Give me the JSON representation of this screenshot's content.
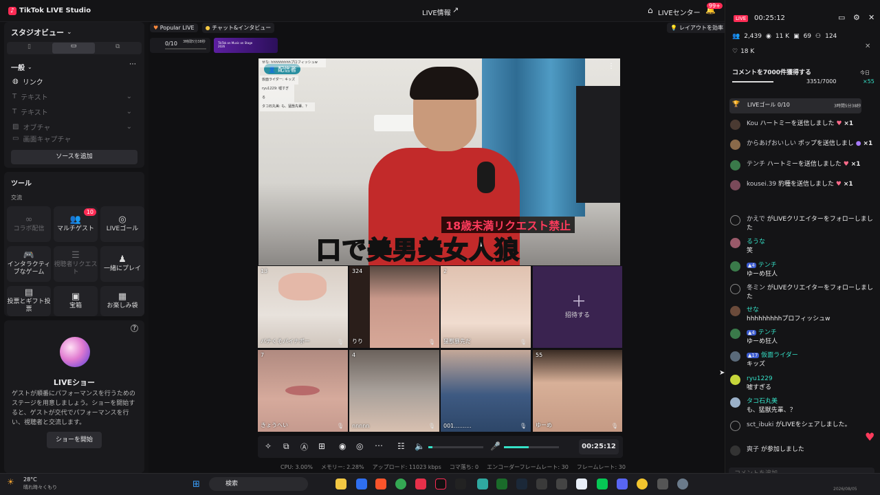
{
  "topbar": {
    "app_title": "TikTok LIVE Studio",
    "center_title": "LIVE情報",
    "live_center": "LIVEセンター",
    "notif_badge": "99+"
  },
  "left": {
    "studio_view": "スタジオビュー",
    "section_general": "一般",
    "sources": [
      "リンク",
      "テキスト",
      "テキスト",
      "オブチャ",
      "画面キャプチャ"
    ],
    "add_source": "ソースを追加",
    "tools_title": "ツール",
    "exchange": "交流",
    "tiles": [
      {
        "label": "コラボ配信",
        "icon": "collab-icon"
      },
      {
        "label": "マルチゲスト",
        "icon": "multiguest-icon",
        "badge": "10"
      },
      {
        "label": "LIVEゴール",
        "icon": "goal-icon"
      },
      {
        "label": "インタラクティブなゲーム",
        "icon": "game-icon"
      },
      {
        "label": "視聴者リクエスト",
        "icon": "request-icon"
      },
      {
        "label": "一緒にプレイ",
        "icon": "play-icon"
      },
      {
        "label": "投票とギフト投票",
        "icon": "vote-icon"
      },
      {
        "label": "宝箱",
        "icon": "treasure-icon"
      },
      {
        "label": "お楽しみ袋",
        "icon": "bag-icon"
      }
    ],
    "show_title": "LIVEショー",
    "show_desc": "ゲストが順番にパフォーマンスを行うためのステージを用意しましょう。ショーを開始すると、ゲストが交代でパフォーマンスを行い、視聴者と交流します。",
    "show_btn": "ショーを開始"
  },
  "center": {
    "tabs": [
      "Popular LIVE",
      "チャット&インタビュー"
    ],
    "progress": "0/10",
    "progress_time": "3時間5分38秒",
    "banner": "TikTok on Music on Stage 2026",
    "layout_hint": "レイアウトを効率",
    "host_tag": "配信者",
    "overlay_lines": [
      "せな: hhhhhhhhhプロフィッシュw",
      "仮面ライダー: キッズ",
      "ryu1229: 嘘すぎる",
      "タコ石丸美: も、猛獣先輩、？"
    ],
    "banner_small": "18歳未満リクエスト禁止",
    "banner_big": "口で美男美女人狼",
    "guests": [
      {
        "name": "バチくそパイナポー",
        "count": "13"
      },
      {
        "name": "りり",
        "count": "324"
      },
      {
        "name": "猛獣暴先だ",
        "count": "2"
      },
      {
        "name": "招待する",
        "count": ""
      },
      {
        "name": "きょうへい",
        "count": "7"
      },
      {
        "name": "nnnnn",
        "count": "4"
      },
      {
        "name": "001..........",
        "count": ""
      },
      {
        "name": "ゆーめ",
        "count": "55"
      }
    ],
    "timer": "00:25:12",
    "stats": {
      "cpu": "CPU: 3.00%",
      "mem": "メモリー: 2.28%",
      "upload": "アップロード: 11023 kbps",
      "drop": "コマ落ち: 0",
      "enc": "エンコーダーフレームレート: 30",
      "fps": "フレームレート: 30"
    }
  },
  "right": {
    "live_badge": "LIVE",
    "timer": "00:25:12",
    "stats": [
      "2,439",
      "11 K",
      "69",
      "124"
    ],
    "likes": "18 K",
    "goal_title": "コメントを7000件獲得する",
    "goal_today": "今日",
    "goal_progress": "3351/7000",
    "goal_mult": "×55",
    "live_goal": "LIVEゴール 0/10",
    "live_goal_time": "3時間5分38秒",
    "messages": [
      {
        "user": "Kou",
        "text": "ハートミーを送信しました",
        "mult": "×1"
      },
      {
        "user": "からあげおいしい",
        "text": "ポップを送信しまし",
        "mult": "×1"
      },
      {
        "user": "テンチ",
        "text": "ハートミーを送信しました",
        "mult": "×1"
      },
      {
        "user": "kousei.39",
        "text": "豹種を送信しました",
        "mult": "×1"
      },
      {
        "user": "かえで",
        "text": "がLIVEクリエイターをフォローしました"
      },
      {
        "user": "るうな",
        "text": "笑"
      },
      {
        "user": "テンチ",
        "text": "ゆーめ狂人"
      },
      {
        "user": "冬ミン",
        "text": "がLIVEクリエイターをフォローしました"
      },
      {
        "user": "せな",
        "text": "hhhhhhhhhプロフィッシュw"
      },
      {
        "user": "テンチ",
        "text": "ゆーめ狂人"
      },
      {
        "user": "仮面ライダー",
        "text": "キッズ"
      },
      {
        "user": "ryu1229",
        "text": "嘘すぎる"
      },
      {
        "user": "タコ石丸美",
        "text": "も、猛獣先輩、？"
      },
      {
        "user": "sct_ibuki",
        "text": "がLIVEをシェアしました。"
      },
      {
        "user": "爽子",
        "text": "が参加しました"
      }
    ],
    "comment_placeholder": "コメントを追加"
  },
  "taskbar": {
    "weather_temp": "28°C",
    "weather_text": "晴れ時々くもり",
    "search": "検索",
    "date": "2026/08/05"
  }
}
